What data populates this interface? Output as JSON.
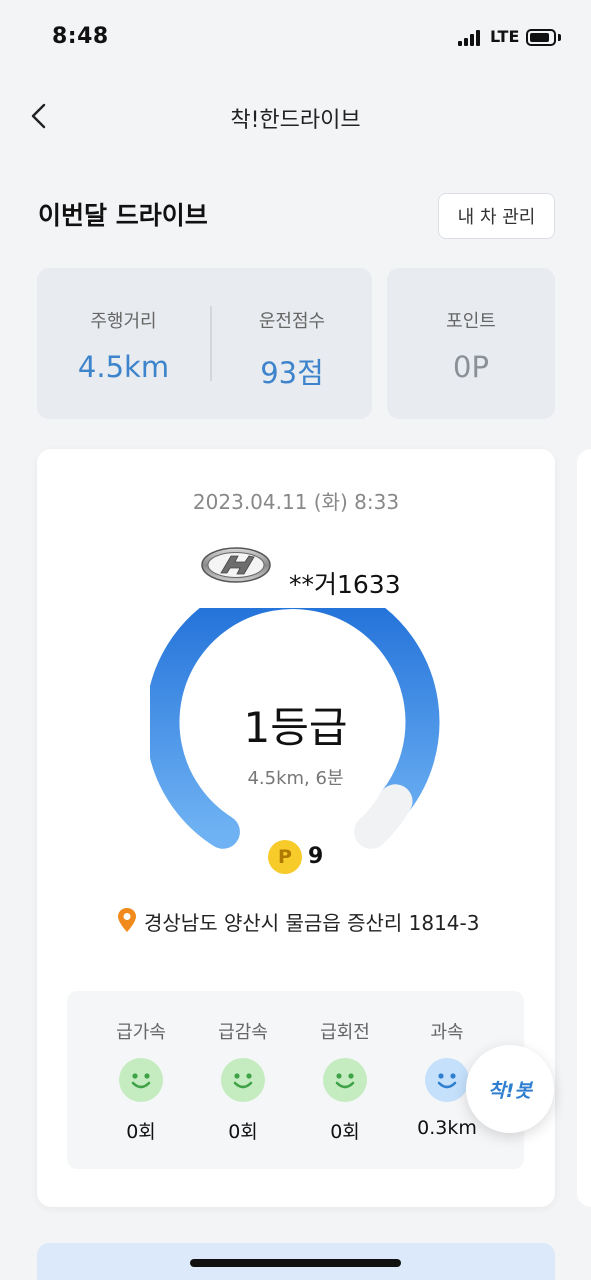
{
  "status": {
    "time": "8:48",
    "network": "LTE"
  },
  "nav": {
    "title": "착!한드라이브"
  },
  "month": {
    "title": "이번달 드라이브",
    "manage_label": "내 차 관리",
    "distance_label": "주행거리",
    "distance_value": "4.5km",
    "score_label": "운전점수",
    "score_value": "93점",
    "points_label": "포인트",
    "points_value": "0P"
  },
  "drive": {
    "date": "2023.04.11 (화) 8:33",
    "plate": "**거1633",
    "grade": "1등급",
    "summary": "4.5km, 6분",
    "point_badge": "P",
    "points_earned": "9",
    "address": "경상남도 양산시 물금읍 증산리 1814-3",
    "events": [
      {
        "label": "급가속",
        "count": "0회",
        "face_color": "green"
      },
      {
        "label": "급감속",
        "count": "0회",
        "face_color": "green"
      },
      {
        "label": "급회전",
        "count": "0회",
        "face_color": "green"
      },
      {
        "label": "과속",
        "count": "0.3km",
        "face_color": "blue"
      }
    ]
  },
  "bot": {
    "label": "착!봇"
  },
  "colors": {
    "accent": "#3d84cc",
    "gauge_start": "#1f6fd8",
    "gauge_end": "#6fb2f3",
    "face_green": "#c5ecc1",
    "face_blue": "#c4e0fb"
  }
}
